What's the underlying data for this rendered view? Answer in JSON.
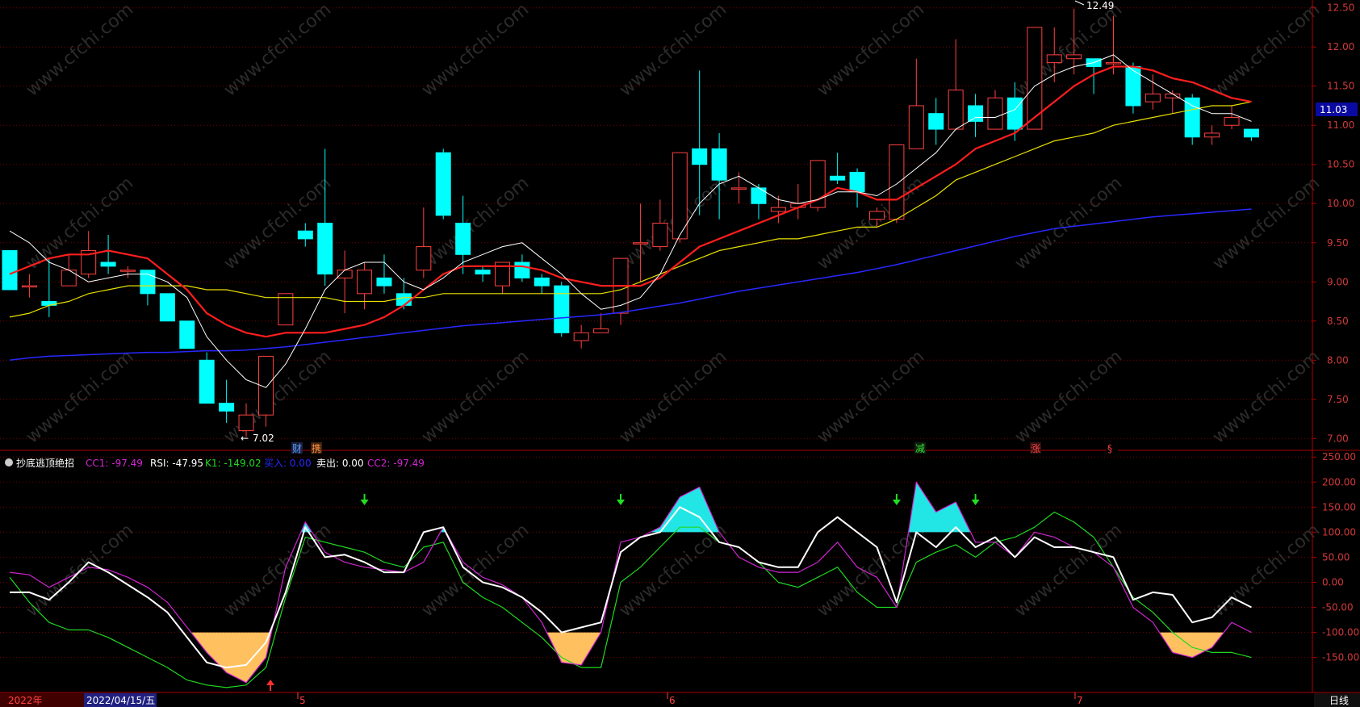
{
  "colors": {
    "bg": "#000000",
    "grid": "#7a0000",
    "axis_line": "#b00000",
    "axis_text": "#d23a3a",
    "up_candle": "#ff4040",
    "down_candle": "#00ffff",
    "ma_white": "#ffffff",
    "ma_red": "#ff1e1e",
    "ma_yellow": "#e8e000",
    "ma_blue": "#2828ff",
    "cc1": "#d026d0",
    "rsi": "#ffffff",
    "k1": "#1fd81f",
    "cyan_fill": "#22e6e6",
    "orange_fill": "#ffc060",
    "watermark": "#2b2b2b"
  },
  "watermark_text": "www.cfchi.com",
  "indicator_header": {
    "name": "抄底逃顶绝招",
    "items": [
      {
        "label": "CC1: -97.49",
        "color": "#d026d0"
      },
      {
        "label": "RSI: -47.95",
        "color": "#ffffff"
      },
      {
        "label": "K1: -149.02",
        "color": "#1fd81f"
      },
      {
        "label": "买入: 0.00",
        "color": "#2828ff"
      },
      {
        "label": "卖出: 0.00",
        "color": "#ffffff"
      },
      {
        "label": "CC2: -97.49",
        "color": "#d026d0"
      }
    ]
  },
  "price_axis": {
    "labels": [
      "12.50",
      "12.00",
      "11.50",
      "11.00",
      "10.50",
      "10.00",
      "9.50",
      "9.00",
      "8.50",
      "8.00",
      "7.50",
      "7.00"
    ],
    "current_price": "11.03"
  },
  "indicator_axis": {
    "labels": [
      "250.00",
      "200.00",
      "150.00",
      "100.00",
      "50.00",
      "0.00",
      "-50.00",
      "-100.00",
      "-150.00"
    ]
  },
  "annotations": {
    "high": "12.49",
    "low": "7.02",
    "low_prefix": "←"
  },
  "event_markers": [
    {
      "text": "财",
      "color": "#4ea3ff",
      "bg": "#202040"
    },
    {
      "text": "携",
      "color": "#ff9040",
      "bg": "#402010"
    },
    {
      "text": "减",
      "color": "#30e030",
      "bg": "#102010"
    },
    {
      "text": "涨",
      "color": "#ff4040",
      "bg": "#301010"
    },
    {
      "text": "§",
      "color": "#ff4040",
      "bg": "#000000"
    }
  ],
  "time_axis": {
    "year": "2022年",
    "selected_date": "2022/04/15/五",
    "months": [
      "5",
      "6",
      "7"
    ],
    "period": "日线"
  },
  "chart_data": {
    "type": "candlestick",
    "price_range": [
      6.9,
      12.6
    ],
    "indicator_range": [
      -215,
      260
    ],
    "candles": [
      [
        9.4,
        8.9,
        9.4,
        8.9
      ],
      [
        8.95,
        8.95,
        9.1,
        8.8
      ],
      [
        8.75,
        8.7,
        9.3,
        8.55
      ],
      [
        8.95,
        9.15,
        9.35,
        8.95
      ],
      [
        9.1,
        9.4,
        9.65,
        9.05
      ],
      [
        9.25,
        9.2,
        9.6,
        9.1
      ],
      [
        9.15,
        9.15,
        9.2,
        9.05
      ],
      [
        9.15,
        8.85,
        9.15,
        8.7
      ],
      [
        8.85,
        8.5,
        8.85,
        8.5
      ],
      [
        8.5,
        8.15,
        8.5,
        8.15
      ],
      [
        8.0,
        7.45,
        8.1,
        7.45
      ],
      [
        7.45,
        7.35,
        7.75,
        7.2
      ],
      [
        7.1,
        7.3,
        7.45,
        7.02
      ],
      [
        7.3,
        8.05,
        8.05,
        7.15
      ],
      [
        8.45,
        8.85,
        8.85,
        8.45
      ],
      [
        9.65,
        9.55,
        9.75,
        9.45
      ],
      [
        9.75,
        9.1,
        10.7,
        8.95
      ],
      [
        9.05,
        9.15,
        9.4,
        8.6
      ],
      [
        8.85,
        9.15,
        9.25,
        8.65
      ],
      [
        9.05,
        8.95,
        9.35,
        8.85
      ],
      [
        8.85,
        8.7,
        9.05,
        8.65
      ],
      [
        9.15,
        9.45,
        9.95,
        9.05
      ],
      [
        10.65,
        9.85,
        10.7,
        9.8
      ],
      [
        9.75,
        9.35,
        10.1,
        9.1
      ],
      [
        9.15,
        9.1,
        9.2,
        9.0
      ],
      [
        8.95,
        9.25,
        9.25,
        8.85
      ],
      [
        9.25,
        9.05,
        9.35,
        9.0
      ],
      [
        9.05,
        8.95,
        9.1,
        8.85
      ],
      [
        8.95,
        8.35,
        9.0,
        8.3
      ],
      [
        8.25,
        8.35,
        8.45,
        8.15
      ],
      [
        8.35,
        8.4,
        8.6,
        8.35
      ],
      [
        8.6,
        9.3,
        9.3,
        8.45
      ],
      [
        9.5,
        9.5,
        10.0,
        9.0
      ],
      [
        9.45,
        9.75,
        10.05,
        9.4
      ],
      [
        9.55,
        10.65,
        10.65,
        9.5
      ],
      [
        10.7,
        10.5,
        11.7,
        9.85
      ],
      [
        10.7,
        10.3,
        10.9,
        9.8
      ],
      [
        10.2,
        10.2,
        10.4,
        10.0
      ],
      [
        10.2,
        10.0,
        10.25,
        9.8
      ],
      [
        9.9,
        9.95,
        10.1,
        9.75
      ],
      [
        9.95,
        10.0,
        10.25,
        9.8
      ],
      [
        9.95,
        10.55,
        10.55,
        9.9
      ],
      [
        10.35,
        10.3,
        10.65,
        10.25
      ],
      [
        10.4,
        10.15,
        10.45,
        9.95
      ],
      [
        9.8,
        9.9,
        9.95,
        9.7
      ],
      [
        9.8,
        10.75,
        10.75,
        9.75
      ],
      [
        10.7,
        11.25,
        11.85,
        10.7
      ],
      [
        11.15,
        10.95,
        11.35,
        10.75
      ],
      [
        10.95,
        11.45,
        12.1,
        10.95
      ],
      [
        11.25,
        11.05,
        11.4,
        10.85
      ],
      [
        10.95,
        11.35,
        11.45,
        10.95
      ],
      [
        11.35,
        10.95,
        11.55,
        10.8
      ],
      [
        10.95,
        12.25,
        12.25,
        10.95
      ],
      [
        11.8,
        11.9,
        12.25,
        11.55
      ],
      [
        11.85,
        11.9,
        12.49,
        11.65
      ],
      [
        11.85,
        11.75,
        11.85,
        11.4
      ],
      [
        11.8,
        11.8,
        12.4,
        11.65
      ],
      [
        11.75,
        11.25,
        11.8,
        11.15
      ],
      [
        11.3,
        11.4,
        11.65,
        11.2
      ],
      [
        11.35,
        11.4,
        11.45,
        11.15
      ],
      [
        11.35,
        10.85,
        11.4,
        10.75
      ],
      [
        10.85,
        10.9,
        11.0,
        10.75
      ],
      [
        11.0,
        11.1,
        11.25,
        10.95
      ],
      [
        10.95,
        10.85,
        10.95,
        10.8
      ]
    ],
    "ma_white": [
      9.65,
      9.5,
      9.25,
      9.15,
      9.0,
      9.05,
      9.1,
      9.1,
      9.0,
      8.8,
      8.3,
      8.0,
      7.75,
      7.65,
      7.95,
      8.4,
      8.9,
      9.15,
      9.25,
      9.25,
      9.0,
      8.9,
      9.05,
      9.25,
      9.35,
      9.45,
      9.5,
      9.3,
      9.1,
      8.85,
      8.65,
      8.7,
      8.8,
      9.1,
      9.6,
      10.0,
      10.25,
      10.35,
      10.2,
      10.05,
      10.0,
      10.05,
      10.15,
      10.15,
      10.1,
      10.25,
      10.45,
      10.65,
      10.95,
      11.1,
      11.1,
      11.2,
      11.5,
      11.65,
      11.75,
      11.8,
      11.9,
      11.7,
      11.55,
      11.4,
      11.25,
      11.15,
      11.15,
      11.05
    ],
    "ma_red": [
      9.1,
      9.2,
      9.3,
      9.35,
      9.35,
      9.4,
      9.35,
      9.3,
      9.1,
      8.9,
      8.6,
      8.45,
      8.35,
      8.3,
      8.35,
      8.35,
      8.35,
      8.4,
      8.45,
      8.55,
      8.7,
      8.9,
      9.1,
      9.2,
      9.2,
      9.2,
      9.2,
      9.15,
      9.05,
      9.0,
      8.95,
      8.95,
      8.95,
      9.05,
      9.25,
      9.45,
      9.55,
      9.65,
      9.75,
      9.85,
      9.95,
      10.05,
      10.2,
      10.15,
      10.05,
      10.05,
      10.2,
      10.35,
      10.5,
      10.7,
      10.8,
      10.9,
      11.1,
      11.3,
      11.5,
      11.65,
      11.75,
      11.75,
      11.7,
      11.6,
      11.55,
      11.45,
      11.35,
      11.3
    ],
    "ma_yellow": [
      8.55,
      8.6,
      8.7,
      8.75,
      8.85,
      8.9,
      8.95,
      8.95,
      8.95,
      8.95,
      8.9,
      8.9,
      8.85,
      8.8,
      8.8,
      8.8,
      8.8,
      8.75,
      8.75,
      8.75,
      8.8,
      8.8,
      8.85,
      8.85,
      8.85,
      8.85,
      8.85,
      8.85,
      8.85,
      8.85,
      8.85,
      8.9,
      9.0,
      9.1,
      9.2,
      9.3,
      9.4,
      9.45,
      9.5,
      9.55,
      9.55,
      9.6,
      9.65,
      9.7,
      9.7,
      9.8,
      9.95,
      10.1,
      10.3,
      10.4,
      10.5,
      10.6,
      10.7,
      10.8,
      10.85,
      10.9,
      11.0,
      11.05,
      11.1,
      11.15,
      11.2,
      11.25,
      11.25,
      11.3
    ],
    "ma_blue": [
      8.0,
      8.03,
      8.05,
      8.06,
      8.07,
      8.08,
      8.09,
      8.1,
      8.1,
      8.11,
      8.12,
      8.12,
      8.13,
      8.15,
      8.17,
      8.2,
      8.23,
      8.26,
      8.29,
      8.32,
      8.35,
      8.38,
      8.41,
      8.44,
      8.46,
      8.48,
      8.5,
      8.52,
      8.54,
      8.56,
      8.58,
      8.61,
      8.65,
      8.69,
      8.73,
      8.78,
      8.83,
      8.88,
      8.92,
      8.96,
      9.0,
      9.04,
      9.08,
      9.12,
      9.17,
      9.22,
      9.28,
      9.34,
      9.4,
      9.46,
      9.52,
      9.58,
      9.63,
      9.68,
      9.71,
      9.74,
      9.77,
      9.8,
      9.83,
      9.85,
      9.87,
      9.89,
      9.91,
      9.93
    ],
    "cc1": [
      20,
      15,
      -10,
      10,
      30,
      25,
      10,
      -10,
      -40,
      -90,
      -140,
      -180,
      -200,
      -150,
      30,
      120,
      60,
      40,
      30,
      25,
      20,
      40,
      110,
      40,
      10,
      -5,
      -30,
      -80,
      -160,
      -165,
      -100,
      80,
      90,
      110,
      170,
      190,
      100,
      50,
      30,
      20,
      20,
      40,
      80,
      30,
      10,
      -50,
      200,
      140,
      160,
      80,
      80,
      50,
      100,
      90,
      70,
      60,
      30,
      -50,
      -80,
      -140,
      -150,
      -130,
      -80,
      -100
    ],
    "rsi": [
      -20,
      -20,
      -35,
      0,
      40,
      20,
      -5,
      -30,
      -60,
      -110,
      -160,
      -170,
      -165,
      -120,
      -20,
      110,
      50,
      55,
      40,
      20,
      20,
      100,
      110,
      30,
      0,
      -10,
      -30,
      -60,
      -100,
      -90,
      -80,
      60,
      90,
      100,
      150,
      130,
      80,
      70,
      40,
      30,
      30,
      100,
      130,
      100,
      70,
      -40,
      100,
      70,
      110,
      70,
      90,
      50,
      90,
      70,
      70,
      60,
      50,
      -35,
      -20,
      -25,
      -80,
      -70,
      -30,
      -50
    ],
    "k1": [
      10,
      -40,
      -80,
      -95,
      -95,
      -110,
      -130,
      -150,
      -170,
      -195,
      -205,
      -210,
      -205,
      -170,
      -30,
      90,
      80,
      70,
      60,
      40,
      30,
      70,
      80,
      0,
      -30,
      -50,
      -80,
      -110,
      -150,
      -170,
      -170,
      0,
      30,
      70,
      110,
      110,
      80,
      70,
      40,
      0,
      -10,
      10,
      30,
      -20,
      -50,
      -50,
      40,
      60,
      75,
      50,
      80,
      90,
      110,
      140,
      120,
      90,
      30,
      -30,
      -60,
      -100,
      -130,
      -140,
      -140,
      -150
    ],
    "signals_down_green": [
      18,
      31,
      45,
      49
    ],
    "signals_up_red": [
      12
    ]
  }
}
